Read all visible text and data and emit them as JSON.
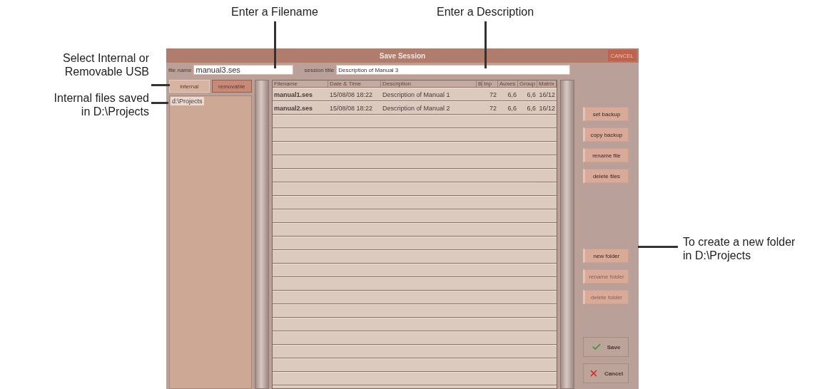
{
  "callouts": {
    "top": [
      "Enter a Filename",
      "Enter a Description"
    ],
    "left": [
      "Select Internal or\nRemovable USB",
      "Internal files saved\nin D:\\Projects"
    ],
    "right": [
      "To create a new folder\nin D:\\Projects"
    ]
  },
  "window": {
    "title": "Save Session",
    "close_button": "CANCEL"
  },
  "fields": [
    {
      "label": "file name",
      "value": "manual3.ses"
    },
    {
      "label": "session title",
      "value": "Description of Manual 3"
    }
  ],
  "location_tabs": [
    {
      "label": "internal",
      "selected": true
    },
    {
      "label": "removable",
      "selected": false
    }
  ],
  "folders": [
    {
      "label": "d:\\Projects",
      "selected": true
    }
  ],
  "table": {
    "columns": [
      "Filename",
      "Date & Time",
      "Description",
      "B",
      "Inp",
      "Auxes",
      "Group",
      "Matrix"
    ],
    "rows": [
      [
        "manual1.ses",
        "15/08/08 18:22",
        "Description of Manual 1",
        "",
        "72",
        "6,6",
        "6,6",
        "16/12"
      ],
      [
        "manual2.ses",
        "15/08/08 18:22",
        "Description of Manual 2",
        "",
        "72",
        "6,6",
        "6,6",
        "16/12"
      ]
    ]
  },
  "actions": [
    {
      "label": "set backup",
      "disabled": false
    },
    {
      "label": "copy backup",
      "disabled": false
    },
    {
      "label": "rename file",
      "disabled": false
    },
    {
      "label": "delete files",
      "disabled": false
    }
  ],
  "folder_actions": [
    {
      "label": "new folder",
      "disabled": false
    },
    {
      "label": "rename folder",
      "disabled": true
    },
    {
      "label": "delete folder",
      "disabled": true
    }
  ],
  "dialog_buttons": [
    {
      "kind": "save",
      "label": "Save"
    },
    {
      "kind": "cancel",
      "label": "Cancel"
    }
  ]
}
